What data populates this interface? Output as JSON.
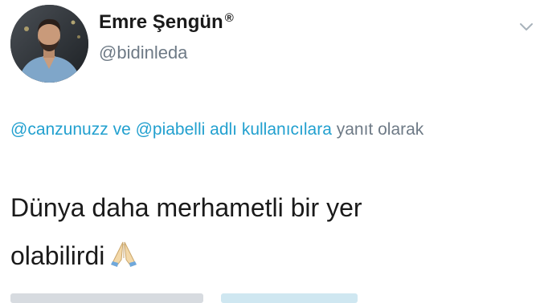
{
  "author": {
    "display_name": "Emre Şengün",
    "verified_mark": "®",
    "handle": "@bidinleda",
    "avatar_icon": "profile-photo"
  },
  "menu": {
    "icon": "chevron-down-icon"
  },
  "reply_context": {
    "mention1": "@canzunuzz",
    "connector": "ve",
    "mention2": "@piabelli",
    "suffix1": "adlı kullanıcılara",
    "suffix2": "yanıt olarak"
  },
  "tweet": {
    "line1": "Dünya daha merhametli bir yer",
    "line2": "olabilirdi",
    "emoji_icon": "folded-hands-icon"
  },
  "colors": {
    "link": "#22a0cf",
    "secondary": "#6e7a86",
    "text": "#1a1a1a"
  }
}
